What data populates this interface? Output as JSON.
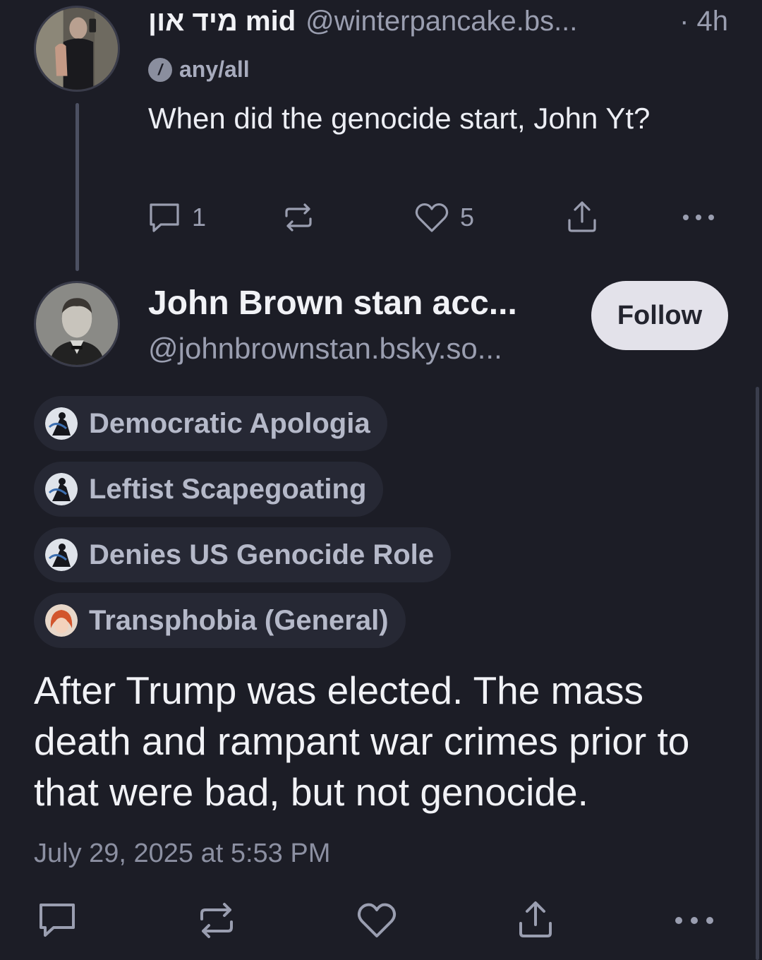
{
  "parent_post": {
    "author_name": "מיד און mid",
    "author_handle": "@winterpancake.bs...",
    "time": "· 4h",
    "label": "any/all",
    "text": "When did the genocide start, John Yt?",
    "reply_count": "1",
    "like_count": "5",
    "icons": [
      "reply-icon",
      "repost-icon",
      "like-icon",
      "share-icon",
      "more-icon"
    ]
  },
  "main_post": {
    "author_name": "John Brown stan acc...",
    "author_handle": "@johnbrownstan.bsky.so...",
    "follow_label": "Follow",
    "labels": [
      {
        "text": "Democratic Apologia"
      },
      {
        "text": "Leftist Scapegoating"
      },
      {
        "text": "Denies US Genocide Role"
      },
      {
        "text": "Transphobia (General)"
      }
    ],
    "text": "After Trump was elected. The mass death and rampant war crimes prior to that were bad, but not genocide.",
    "date": "July 29, 2025 at 5:53 PM",
    "icons": [
      "reply-icon",
      "repost-icon",
      "like-icon",
      "share-icon",
      "more-icon"
    ]
  },
  "colors": {
    "background": "#1c1d26",
    "text": "#f1f2f6",
    "muted": "#9a9eb0",
    "follow_button": "#e3e2ea",
    "badge": "#262834"
  }
}
